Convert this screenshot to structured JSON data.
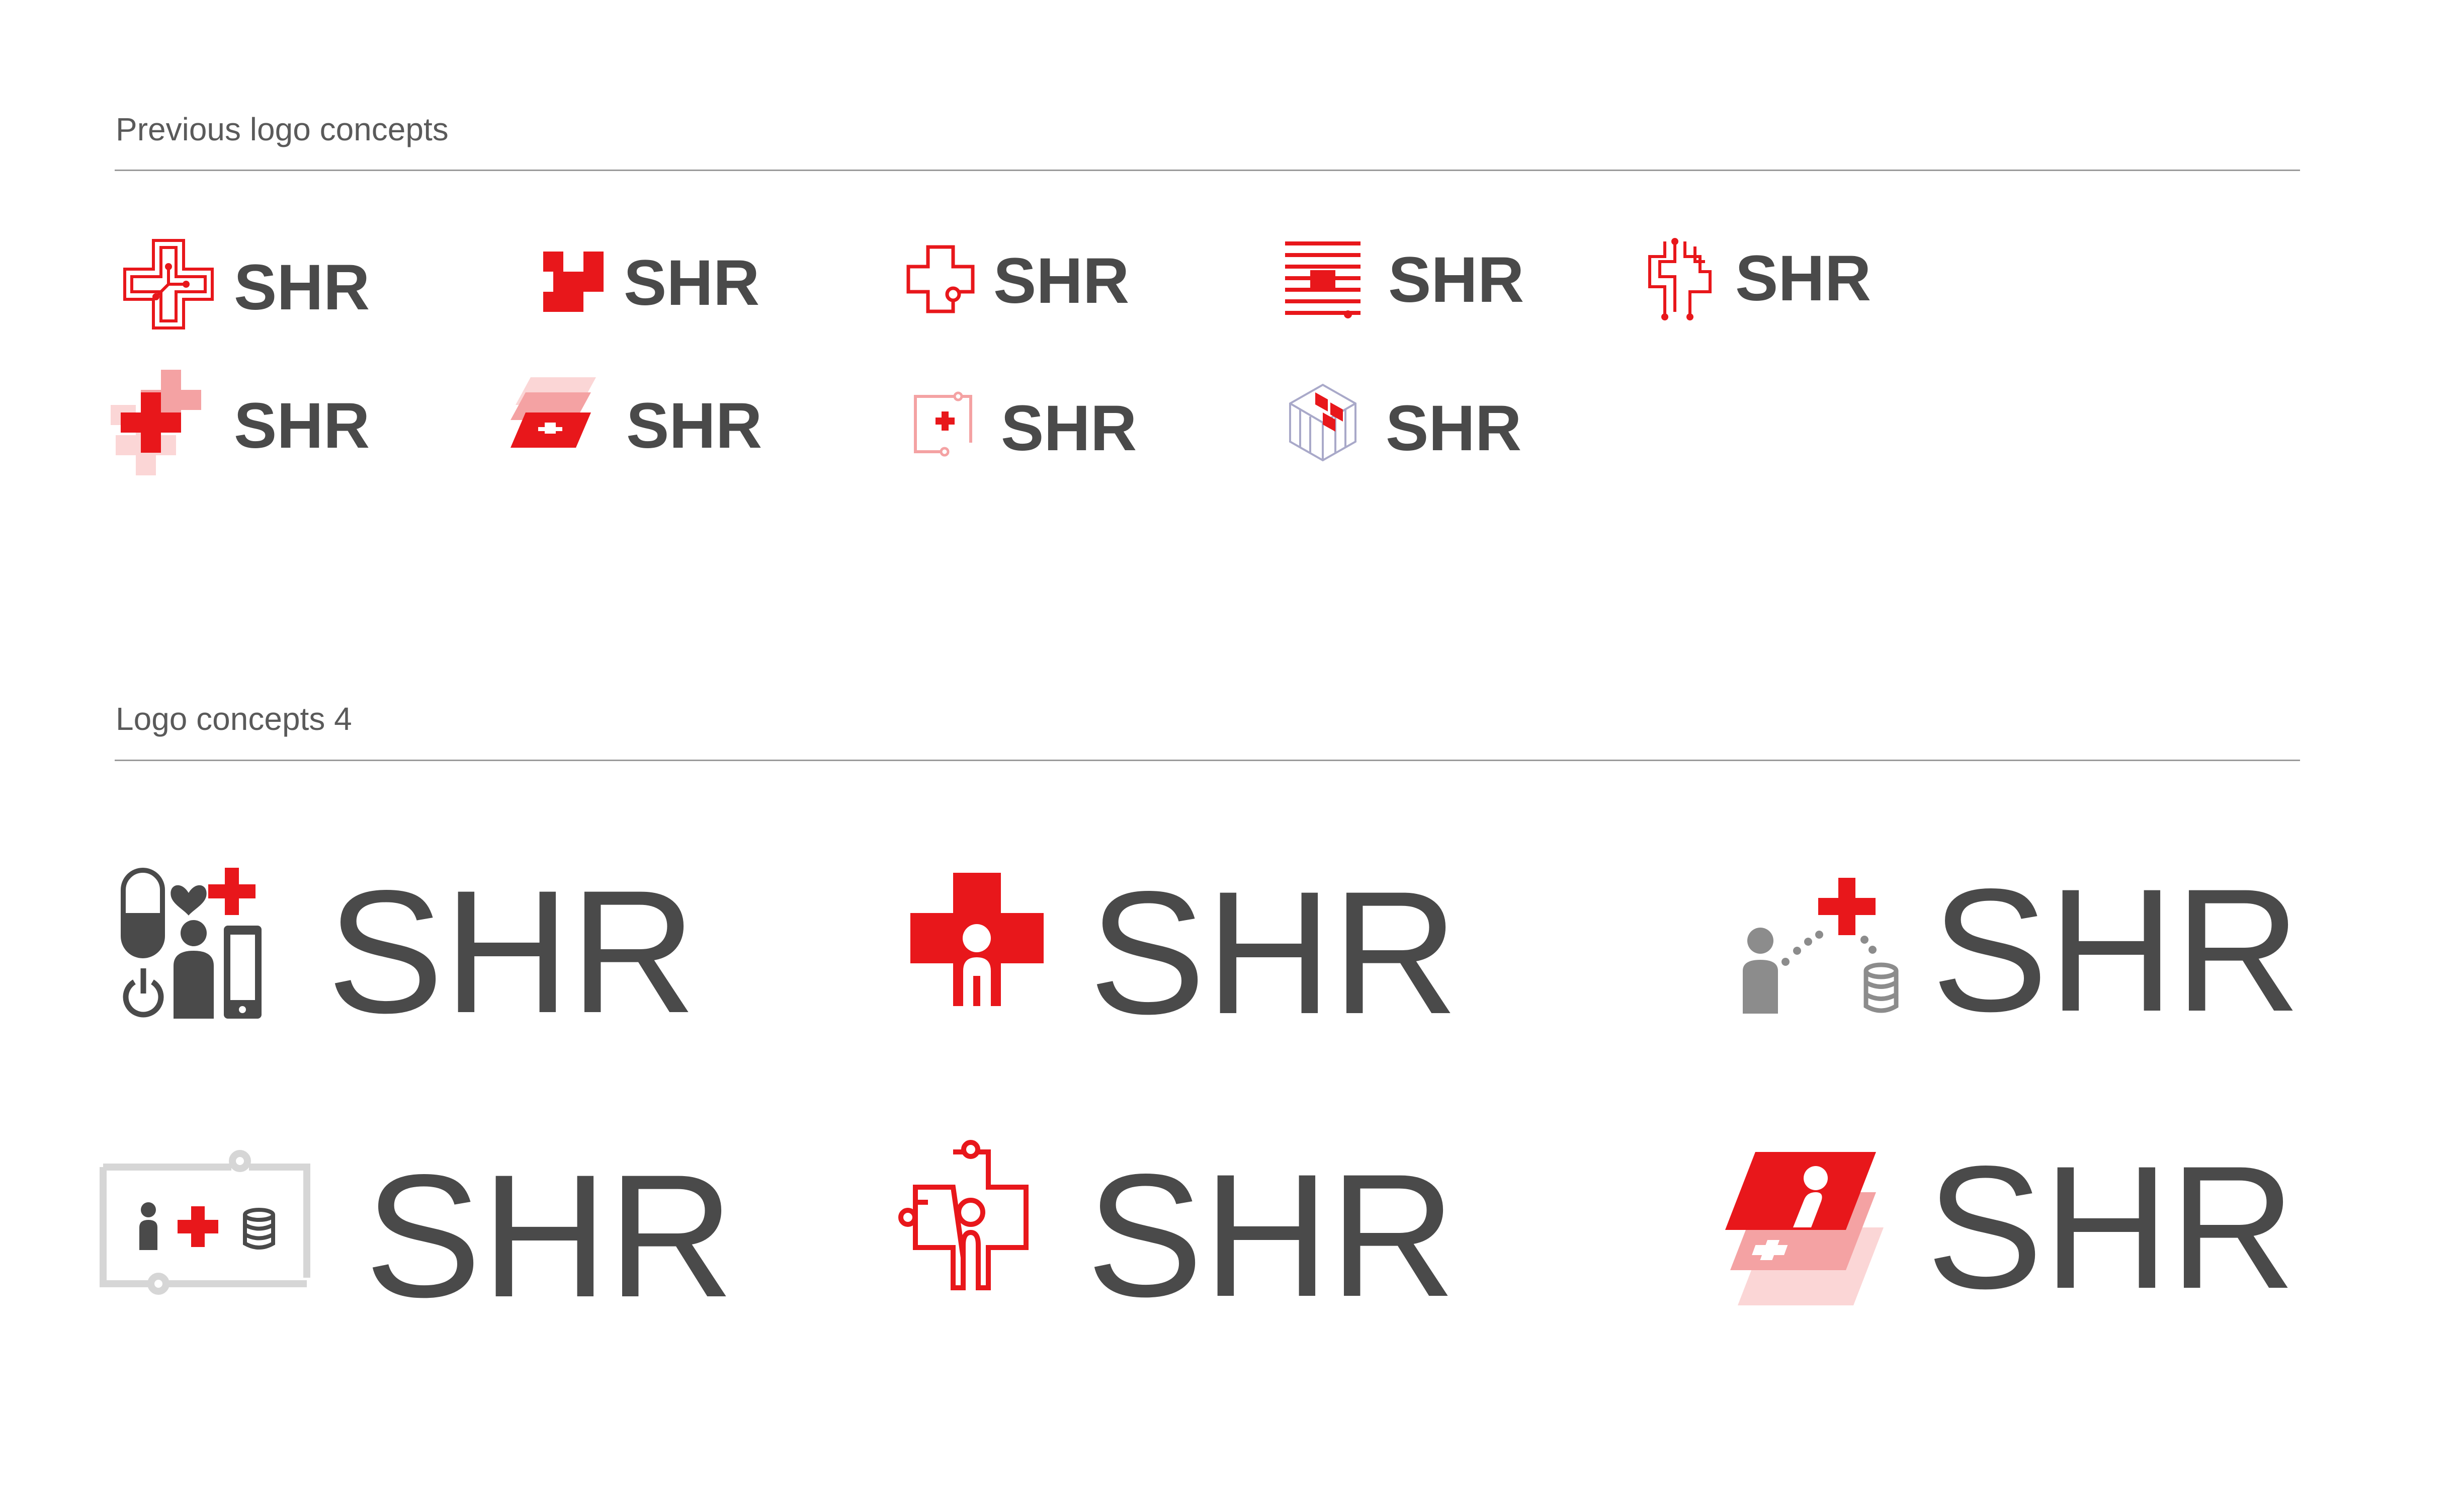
{
  "sections": {
    "previous": {
      "title": "Previous logo concepts"
    },
    "current": {
      "title": "Logo concepts 4"
    }
  },
  "brand": {
    "wordmark": "SHR"
  },
  "colors": {
    "accent": "#e8171b",
    "accent_light": "#f4a2a3",
    "accent_pale": "#fbd6d6",
    "wordmark": "#4a4a4a",
    "icon_gray": "#8c8c8c",
    "frame_gray": "#d6d6d6",
    "cube_gray": "#a9a9c9"
  },
  "previous_logos": [
    {
      "icon": "circuit-cross-icon",
      "wordmark": "SHR"
    },
    {
      "icon": "pixel-cross-icon",
      "wordmark": "SHR"
    },
    {
      "icon": "outline-cross-node-icon",
      "wordmark": "SHR"
    },
    {
      "icon": "striped-cross-icon",
      "wordmark": "SHR"
    },
    {
      "icon": "circuit-trace-cross-icon",
      "wordmark": "SHR"
    },
    {
      "icon": "layered-cross-icon",
      "wordmark": "SHR"
    },
    {
      "icon": "skewed-stack-cross-icon",
      "wordmark": "SHR"
    },
    {
      "icon": "boxed-cross-node-icon",
      "wordmark": "SHR"
    },
    {
      "icon": "cube-cross-icon",
      "wordmark": "SHR"
    }
  ],
  "current_logos": [
    {
      "icon": "health-devices-icon",
      "wordmark": "SHR"
    },
    {
      "icon": "person-cross-icon",
      "wordmark": "SHR"
    },
    {
      "icon": "person-data-cross-icon",
      "wordmark": "SHR"
    },
    {
      "icon": "framed-record-icon",
      "wordmark": "SHR"
    },
    {
      "icon": "outline-person-cross-icon",
      "wordmark": "SHR"
    },
    {
      "icon": "skewed-person-stack-icon",
      "wordmark": "SHR"
    }
  ]
}
